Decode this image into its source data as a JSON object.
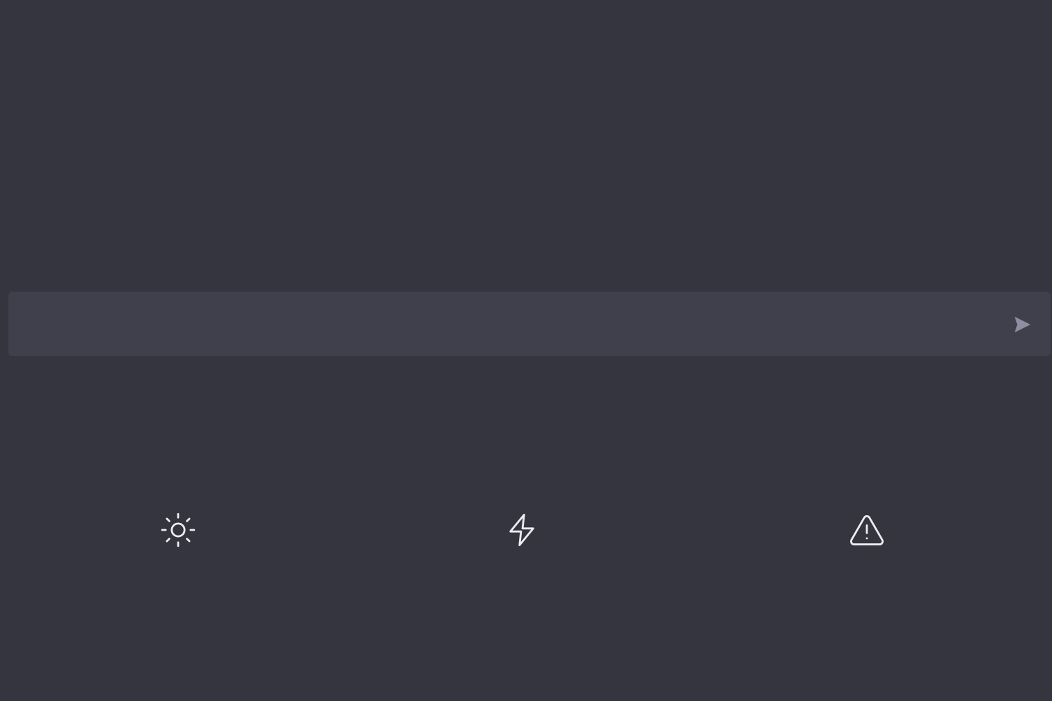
{
  "composer": {
    "input_value": "",
    "input_placeholder": "",
    "send_icon": "send-icon"
  },
  "features": [
    {
      "icon": "sun-icon"
    },
    {
      "icon": "lightning-bolt-icon"
    },
    {
      "icon": "warning-triangle-icon"
    }
  ],
  "colors": {
    "background": "#35353f",
    "composer_background": "#3f404b",
    "icon_stroke": "#ececf1",
    "send_icon": "#8e8ea0"
  }
}
